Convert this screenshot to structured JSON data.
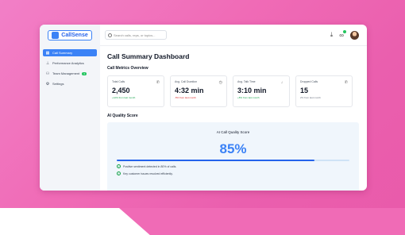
{
  "app": {
    "name": "CallSense"
  },
  "search": {
    "placeholder": "Search calls, reps, or topics..."
  },
  "sidebar": {
    "items": [
      {
        "label": "Call Summary",
        "active": true,
        "icon": "grid-icon"
      },
      {
        "label": "Performance Analytics",
        "active": false,
        "icon": "chart-icon"
      },
      {
        "label": "Team Management",
        "active": false,
        "icon": "users-icon",
        "badge": "3"
      },
      {
        "label": "Settings",
        "active": false,
        "icon": "gear-icon"
      }
    ]
  },
  "main": {
    "title": "Call Summary Dashboard",
    "metrics_title": "Call Metrics Overview",
    "metrics": [
      {
        "label": "Total Calls",
        "value": "2,450",
        "change": "+12% from last month",
        "color": "#16a34a",
        "icon": "phone-icon"
      },
      {
        "label": "Avg. Call Duration",
        "value": "4:32 min",
        "change": "-5% from last month",
        "color": "#dc2626",
        "icon": "clock-icon"
      },
      {
        "label": "Avg. Talk Time",
        "value": "3:10 min",
        "change": "+8% from last month",
        "color": "#16a34a",
        "icon": "mic-icon"
      },
      {
        "label": "Dropped Calls",
        "value": "15",
        "change": "2% from last month",
        "color": "#6b7280",
        "icon": "phone-missed-icon"
      }
    ],
    "quality_title": "AI Quality Score",
    "quality": {
      "panel_title": "AI Call Quality Score",
      "score": "85%",
      "progress": 0.85,
      "items": [
        "Positive sentiment detected in 80% of calls.",
        "Key customer issues resolved efficiently."
      ]
    }
  },
  "colors": {
    "accent": "#3b82f6",
    "background": "#f06bb6"
  }
}
